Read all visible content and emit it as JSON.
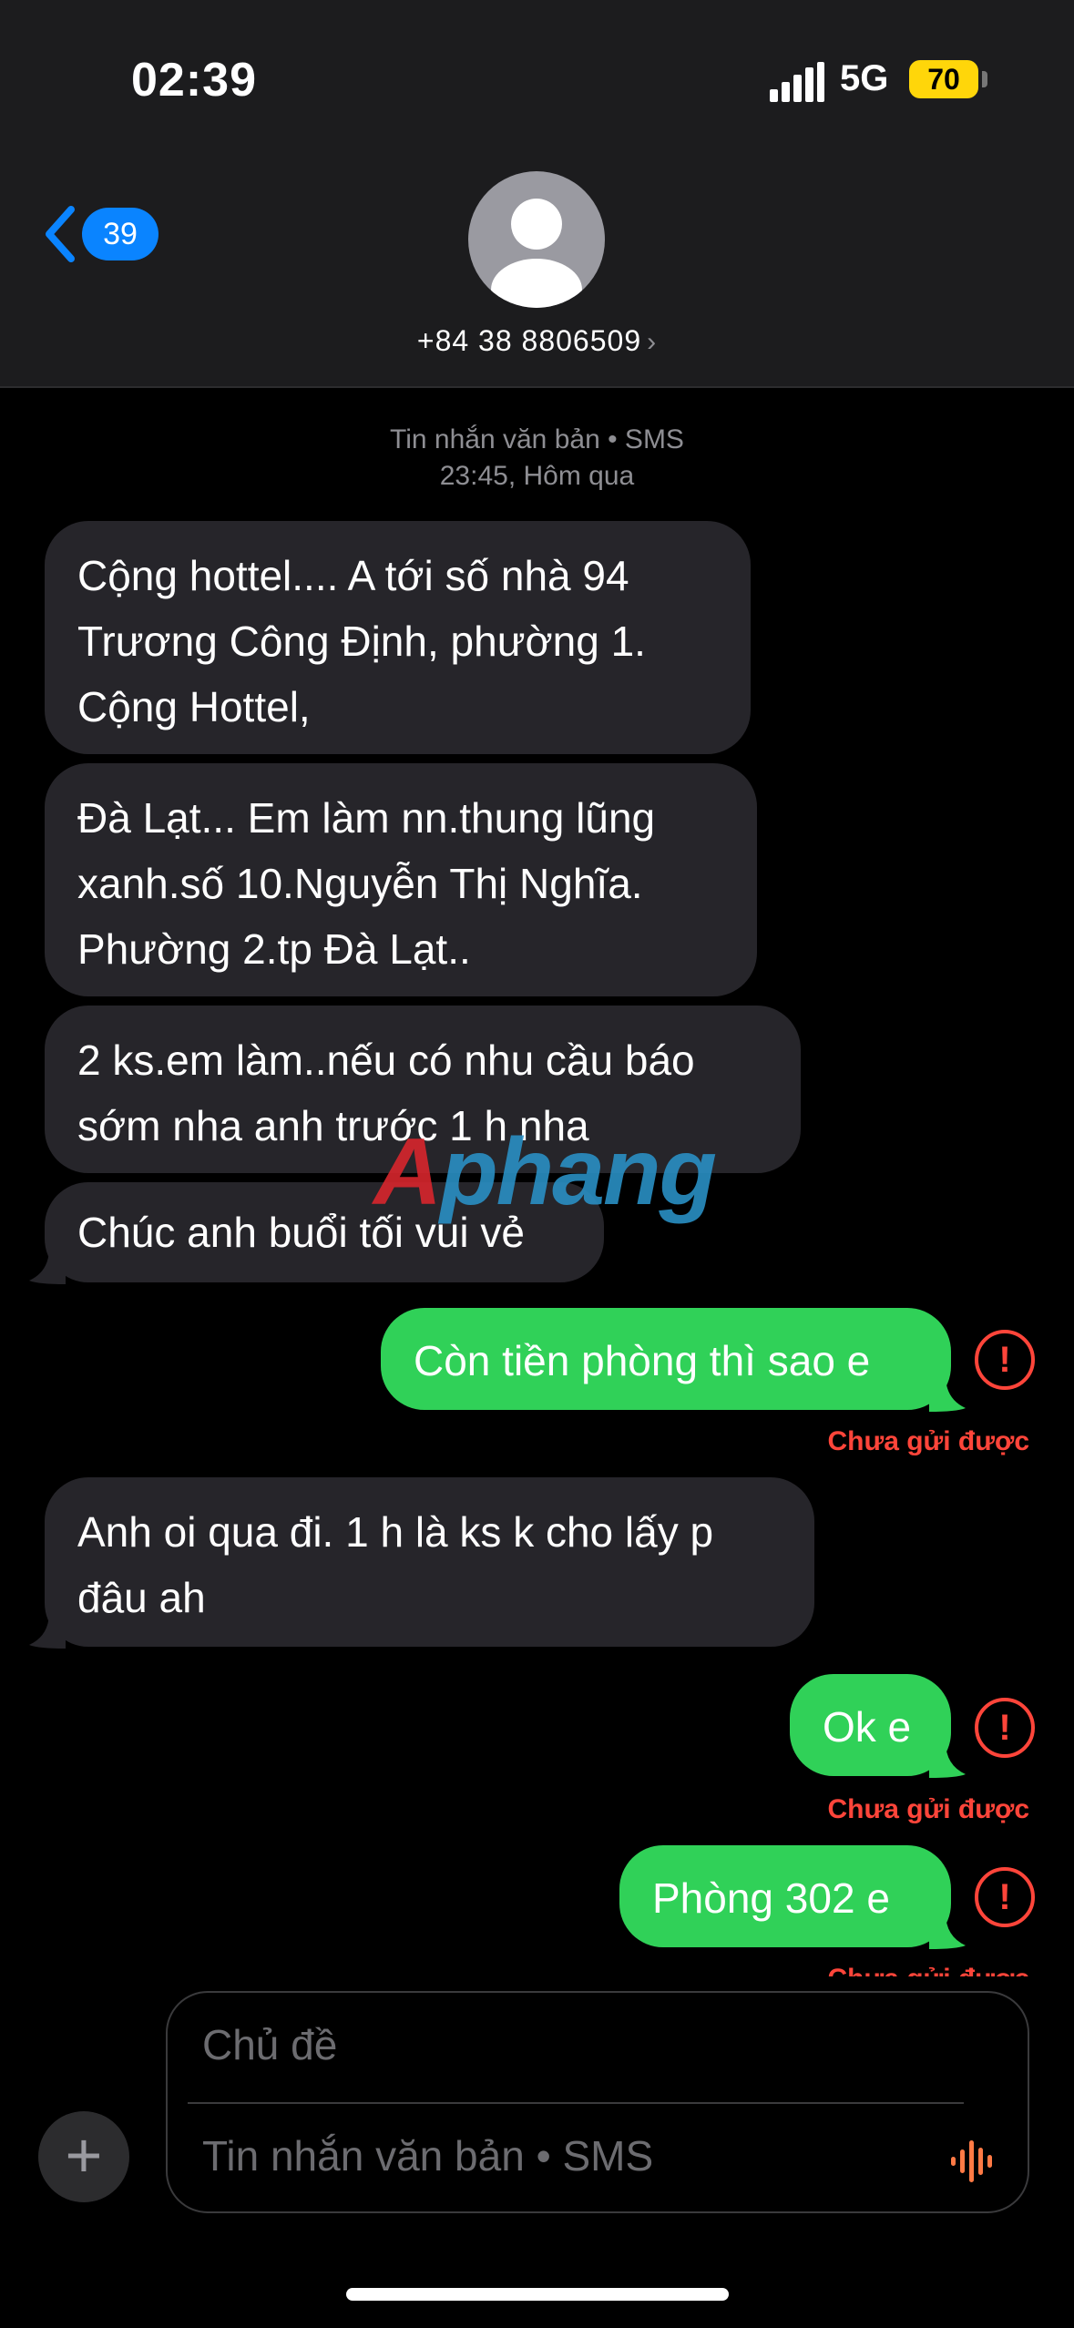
{
  "status": {
    "time": "02:39",
    "network": "5G",
    "battery": "70"
  },
  "nav": {
    "back_count": "39",
    "contact": "+84 38 8806509",
    "contact_chevron": "›"
  },
  "thread": {
    "service_label": "Tin nhắn văn bản • SMS",
    "timestamp": "23:45, Hôm qua"
  },
  "messages": [
    {
      "direction": "in",
      "text": " Cộng hottel.... A tới số nhà 94 Trương Công Định, phường 1. Cộng Hottel,"
    },
    {
      "direction": "in",
      "text": "Đà Lạt... Em làm nn.thung lũng xanh.số 10.Nguyễn Thị Nghĩa. Phường 2.tp Đà Lạt.."
    },
    {
      "direction": "in",
      "text": "2 ks.em làm..nếu có nhu cầu báo sớm nha anh trước 1 h nha"
    },
    {
      "direction": "in",
      "text": "Chúc anh buổi tối vui vẻ"
    },
    {
      "direction": "out",
      "text": "Còn tiền phòng thì sao e",
      "status": "Chưa gửi được"
    },
    {
      "direction": "in",
      "text": "Anh oi qua đi. 1 h là ks k cho lấy p đâu ah"
    },
    {
      "direction": "out",
      "text": "Ok e",
      "status": "Chưa gửi được"
    },
    {
      "direction": "out",
      "text": "Phòng 302 e",
      "status": "Chưa gửi được"
    }
  ],
  "error_glyph": "!",
  "watermark": {
    "part1": "A",
    "part2": "phang"
  },
  "compose": {
    "subject_placeholder": "Chủ đề",
    "body_placeholder": "Tin nhắn văn bản • SMS",
    "plus_glyph": "+"
  },
  "colors": {
    "outgoing": "#30d158",
    "incoming": "#26252a",
    "error": "#ff453a",
    "accent": "#0a84ff",
    "battery": "#ffd60a"
  },
  "icons": [
    "back-chevron-icon",
    "avatar-icon",
    "signal-icon",
    "battery-icon",
    "error-icon",
    "plus-icon",
    "audio-waveform-icon"
  ]
}
